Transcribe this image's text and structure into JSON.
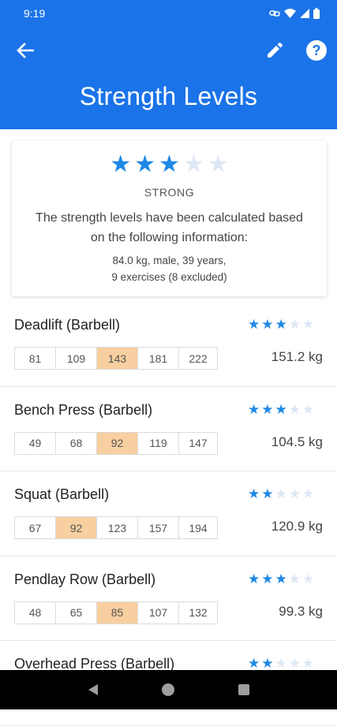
{
  "status_bar": {
    "time": "9:19"
  },
  "app_bar": {
    "title": "Strength Levels"
  },
  "summary": {
    "stars_filled": 3,
    "stars_total": 5,
    "level": "STRONG",
    "description": "The strength levels have been calculated based on the following information:",
    "info_line1": "84.0 kg, male, 39 years,",
    "info_line2": "9 exercises (8 excluded)"
  },
  "exercises": [
    {
      "name": "Deadlift (Barbell)",
      "stars_filled": 3,
      "levels": [
        "81",
        "109",
        "143",
        "181",
        "222"
      ],
      "highlight": 2,
      "value": "151.2 kg"
    },
    {
      "name": "Bench Press (Barbell)",
      "stars_filled": 3,
      "levels": [
        "49",
        "68",
        "92",
        "119",
        "147"
      ],
      "highlight": 2,
      "value": "104.5 kg"
    },
    {
      "name": "Squat (Barbell)",
      "stars_filled": 2,
      "levels": [
        "67",
        "92",
        "123",
        "157",
        "194"
      ],
      "highlight": 1,
      "value": "120.9 kg"
    },
    {
      "name": "Pendlay Row (Barbell)",
      "stars_filled": 3,
      "levels": [
        "48",
        "65",
        "85",
        "107",
        "132"
      ],
      "highlight": 2,
      "value": "99.3 kg"
    },
    {
      "name": "Overhead Press (Barbell)",
      "stars_filled": 2,
      "levels": [],
      "highlight": -1,
      "value": ""
    }
  ],
  "colors": {
    "primary": "#1a73e8",
    "star": "#1e88e5",
    "star_off": "#dde8f5",
    "highlight": "#f8cfa0"
  },
  "icons": {
    "back": "arrow-back-icon",
    "edit": "pencil-icon",
    "help": "help-icon"
  }
}
